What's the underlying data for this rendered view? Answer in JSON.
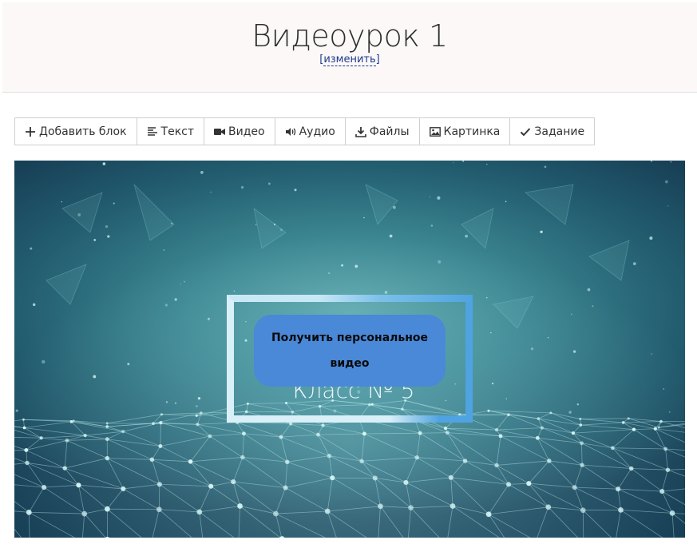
{
  "header": {
    "title": "Видеоурок 1",
    "rename_open": "[",
    "rename_label": "изменить",
    "rename_close": "]"
  },
  "toolbar": {
    "items": [
      {
        "label": "Добавить блок",
        "icon": "plus-icon"
      },
      {
        "label": "Текст",
        "icon": "text-align-icon"
      },
      {
        "label": "Видео",
        "icon": "video-camera-icon"
      },
      {
        "label": "Аудио",
        "icon": "volume-icon"
      },
      {
        "label": "Файлы",
        "icon": "download-icon"
      },
      {
        "label": "Картинка",
        "icon": "image-icon"
      },
      {
        "label": "Задание",
        "icon": "check-icon"
      }
    ]
  },
  "video": {
    "overlay_text": "Класс № 5",
    "cta_label": "Получить персональное видео"
  },
  "colors": {
    "header_bg": "#fcf8f8",
    "link": "#1d3b8a",
    "cta_bg": "#4a88d8",
    "video_bg": "#3c8792"
  }
}
